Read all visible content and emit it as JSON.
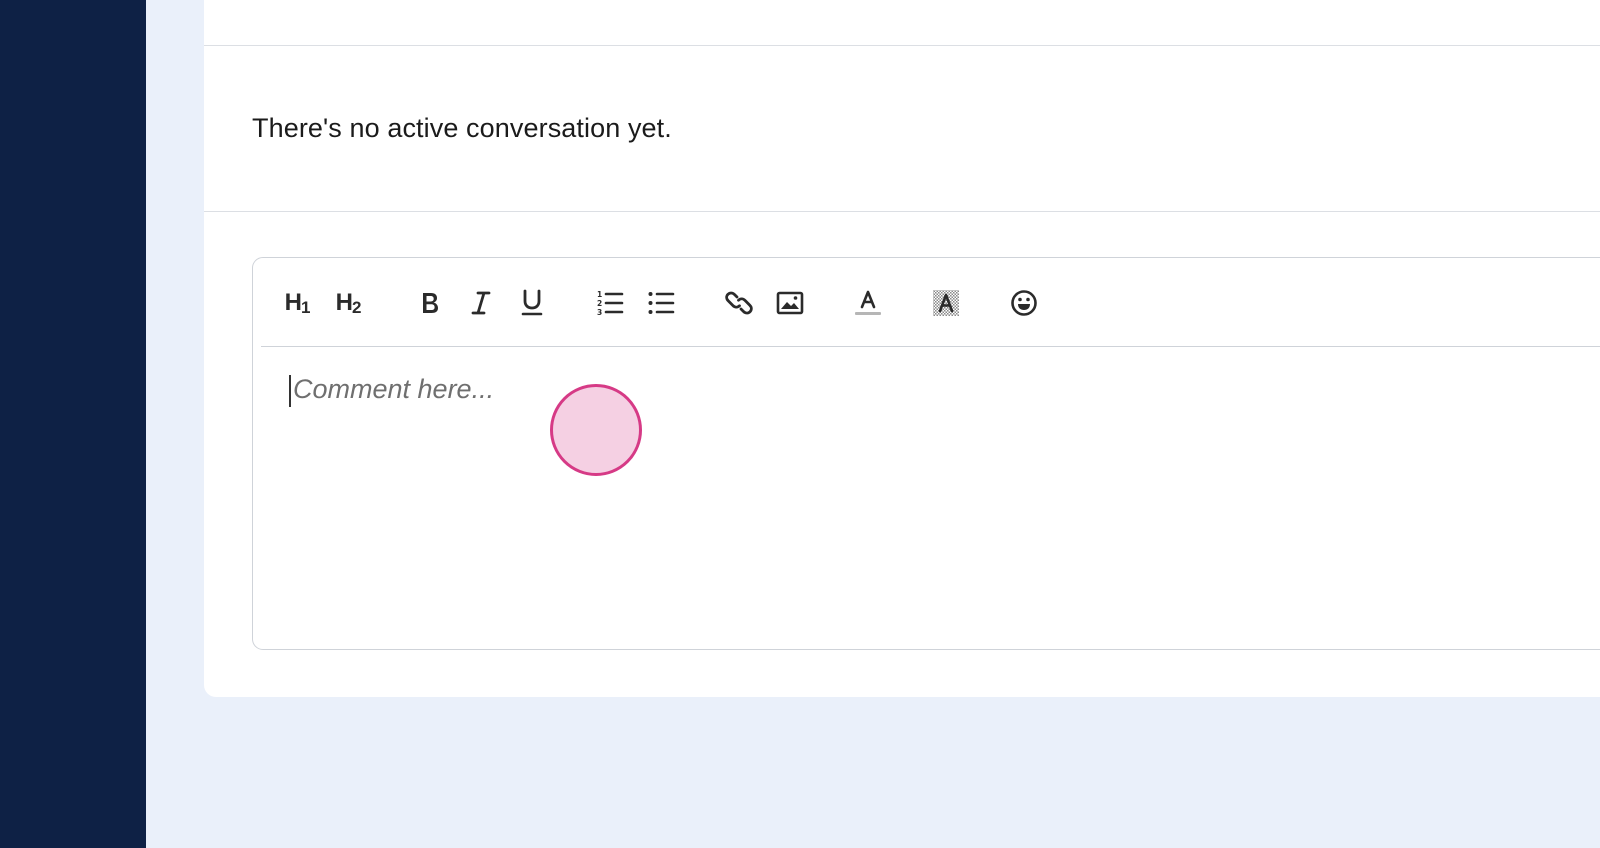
{
  "conversation": {
    "empty_message": "There's no active conversation yet."
  },
  "editor": {
    "placeholder": "Comment here...",
    "toolbar": {
      "h1": {
        "main": "H",
        "sub": "1",
        "icon": "heading-1-icon"
      },
      "h2": {
        "main": "H",
        "sub": "2",
        "icon": "heading-2-icon"
      },
      "bold": {
        "icon": "bold-icon"
      },
      "italic": {
        "icon": "italic-icon"
      },
      "underline": {
        "icon": "underline-icon"
      },
      "ordered_list": {
        "icon": "ordered-list-icon"
      },
      "bullet_list": {
        "icon": "bullet-list-icon"
      },
      "link": {
        "icon": "link-icon"
      },
      "image": {
        "icon": "image-icon"
      },
      "text_color": {
        "icon": "text-color-icon"
      },
      "highlight": {
        "icon": "highlight-color-icon"
      },
      "emoji": {
        "icon": "emoji-icon"
      }
    }
  },
  "colors": {
    "sidebar": "#0e2145",
    "page_bg": "#eaf0fa",
    "cursor_fill": "#f5d0e3",
    "cursor_border": "#d63a86"
  }
}
